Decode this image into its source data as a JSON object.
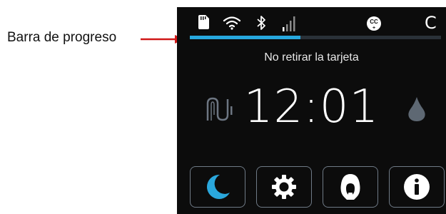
{
  "annotation": {
    "label": "Barra de progreso"
  },
  "status_bar": {
    "icons": [
      "sd-card-icon",
      "wifi-icon",
      "bluetooth-icon",
      "signal-strength-icon",
      "cc-icon"
    ],
    "badge_letter": "C"
  },
  "progress": {
    "fraction": 0.44,
    "accent_color": "#27a8de"
  },
  "main": {
    "message": "No retirar la tarjeta",
    "clock": "12:01",
    "left_icon": "tube-connector-icon",
    "right_icon": "water-drop-icon"
  },
  "buttons": [
    {
      "icon": "moon-icon"
    },
    {
      "icon": "gear-icon"
    },
    {
      "icon": "nasal-mask-icon"
    },
    {
      "icon": "info-icon"
    }
  ]
}
